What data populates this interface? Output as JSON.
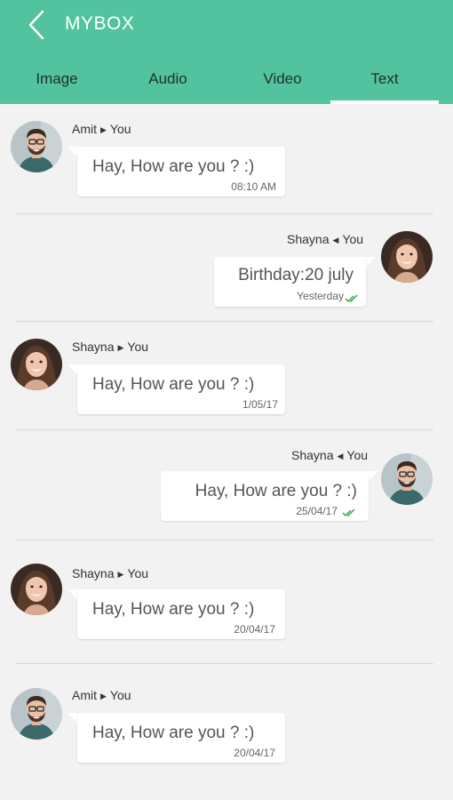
{
  "header": {
    "title": "MYBOX",
    "background_color": "#52c39e",
    "back_icon": "chevron-left-icon"
  },
  "tabs": [
    {
      "label": "Image",
      "active": false
    },
    {
      "label": "Audio",
      "active": false
    },
    {
      "label": "Video",
      "active": false
    },
    {
      "label": "Text",
      "active": true
    }
  ],
  "messages": [
    {
      "sender": "Amit",
      "recipient": "You",
      "text": "Hay, How are you ? :)",
      "time": "08:10 AM",
      "direction": "incoming",
      "read": false
    },
    {
      "sender": "Shayna",
      "recipient": "You",
      "text": "Birthday:20 july",
      "time": "Yesterday",
      "direction": "outgoing",
      "read": true
    },
    {
      "sender": "Shayna",
      "recipient": "You",
      "text": "Hay, How are you ? :)",
      "time": "1/05/17",
      "direction": "incoming",
      "read": false
    },
    {
      "sender": "Shayna",
      "recipient": "You",
      "text": "Hay, How are you ? :)",
      "time": "25/04/17",
      "direction": "outgoing",
      "read": true
    },
    {
      "sender": "Shayna",
      "recipient": "You",
      "text": "Hay, How are you ? :)",
      "time": "20/04/17",
      "direction": "incoming",
      "read": false
    },
    {
      "sender": "Amit",
      "recipient": "You",
      "text": "Hay, How are you ? :)",
      "time": "20/04/17",
      "direction": "incoming",
      "read": false
    }
  ],
  "read_check_color": "#2ea44f"
}
